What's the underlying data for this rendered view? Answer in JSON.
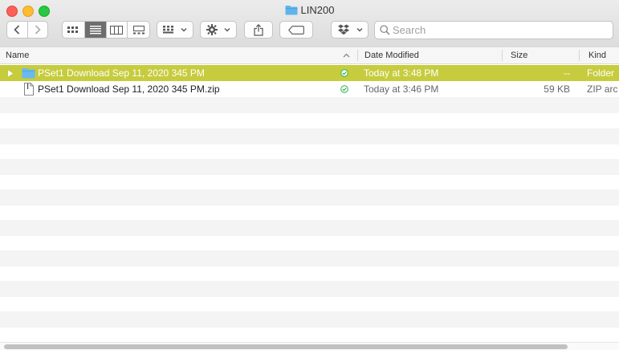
{
  "window": {
    "title": "LIN200"
  },
  "toolbar": {
    "back_icon": "chevron-left-icon",
    "forward_icon": "chevron-right-icon",
    "view_modes": [
      "icon-view",
      "list-view",
      "column-view",
      "gallery-view"
    ],
    "active_view": "list-view",
    "search": {
      "placeholder": "Search",
      "value": ""
    }
  },
  "columns": {
    "name": "Name",
    "date_modified": "Date Modified",
    "size": "Size",
    "kind": "Kind"
  },
  "files": [
    {
      "name": "PSet1 Download Sep 11, 2020 345 PM",
      "date": "Today at 3:48 PM",
      "size": "--",
      "kind": "Folder",
      "type": "folder",
      "synced": true,
      "selected": true
    },
    {
      "name": "PSet1 Download Sep 11, 2020 345 PM.zip",
      "date": "Today at 3:46 PM",
      "size": "59 KB",
      "kind": "ZIP arc",
      "type": "zip",
      "synced": true,
      "selected": false
    }
  ],
  "colors": {
    "selection": "#c6cc3d",
    "folder": "#5fb4ec",
    "sync_ok": "#2eb34a"
  }
}
